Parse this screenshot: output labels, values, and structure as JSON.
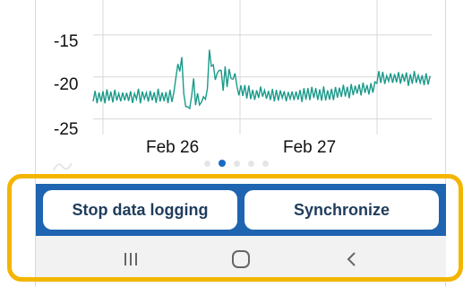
{
  "chart_data": {
    "type": "line",
    "y_ticks": [
      "-15",
      "-20",
      "-25"
    ],
    "x_ticks": [
      "Feb 26",
      "Feb 27"
    ],
    "ylim": [
      -26,
      -10
    ],
    "grid": true,
    "series_color": "#1a9a8a"
  },
  "pager": {
    "count": 5,
    "active_index": 1
  },
  "actions": {
    "stop_label": "Stop data logging",
    "sync_label": "Synchronize"
  },
  "colors": {
    "action_bar": "#1e64b0",
    "highlight": "#f3b600",
    "line": "#1a9a8a"
  },
  "navbar": {
    "recents_icon": "recents-icon",
    "home_icon": "home-icon",
    "back_icon": "back-icon"
  }
}
